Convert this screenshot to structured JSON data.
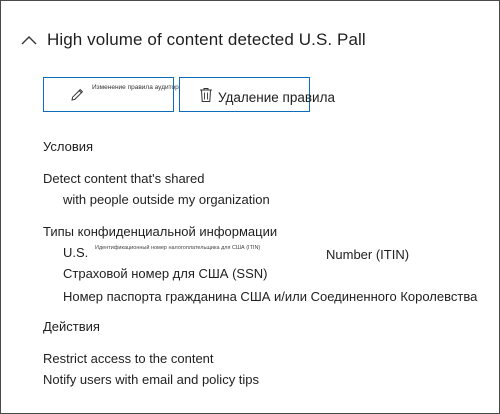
{
  "rule": {
    "title": "High volume of content detected U.S. Pall"
  },
  "buttons": {
    "edit_label": "Изменение правила аудитории",
    "delete_label": "Удаление правила"
  },
  "conditions": {
    "heading": "Условия",
    "detect_line1": "Detect content that's shared",
    "detect_line2": "with people outside my organization"
  },
  "sensitive_info": {
    "heading": "Типы конфиденциальной информации",
    "itin_prefix": "U.S.",
    "itin_small": "Идентификационный номер налогоплательщика для США (ITIN)",
    "itin_suffix": "Number (ITIN)",
    "ssn": "Страховой номер для США (SSN)",
    "passport": "Номер паспорта гражданина США и/или Соединенного Королевства"
  },
  "actions": {
    "heading": "Действия",
    "restrict": "Restrict access to the content",
    "notify": "Notify users with email and policy tips"
  },
  "icons": {
    "collapse": "chevron-up-icon",
    "edit": "pencil-icon",
    "delete": "trash-icon"
  },
  "colors": {
    "button_border": "#0f6cbd",
    "frame_border": "#4a4a4a",
    "text": "#1f1f1f"
  }
}
